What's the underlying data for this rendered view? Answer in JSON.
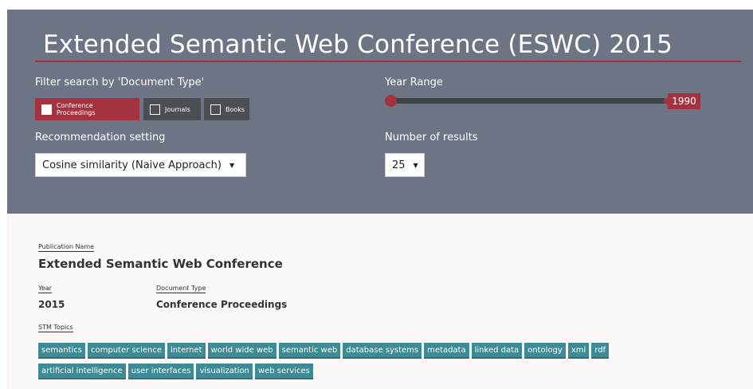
{
  "header": {
    "title": "Extended Semantic Web Conference (ESWC) 2015"
  },
  "filters": {
    "doc_type_label": "Filter search by 'Document Type'",
    "doc_types": [
      {
        "label": "Conference Proceedings",
        "checked": true
      },
      {
        "label": "Journals",
        "checked": false
      },
      {
        "label": "Books",
        "checked": false
      }
    ],
    "year_range_label": "Year Range",
    "year_value": "1990",
    "recommendation_label": "Recommendation setting",
    "recommendation_value": "Cosine similarity (Naive Approach)",
    "num_results_label": "Number of results",
    "num_results_value": "25"
  },
  "publication": {
    "name_label": "Publication Name",
    "name": "Extended Semantic Web Conference",
    "year_label": "Year",
    "year": "2015",
    "doc_type_label": "Document Type",
    "doc_type": "Conference Proceedings",
    "topics_label": "STM Topics",
    "topics_row1": [
      "semantics",
      "computer science",
      "internet",
      "world wide web",
      "semantic web",
      "database systems",
      "metadata",
      "linked data",
      "ontology",
      "xml",
      "rdf"
    ],
    "topics_row2": [
      "artificial intelligence",
      "user interfaces",
      "visualization",
      "web services"
    ]
  },
  "colors": {
    "panel": "#6d7584",
    "accent": "#a7323f",
    "tag": "#3f8b95",
    "background": "#fcf8f7"
  }
}
